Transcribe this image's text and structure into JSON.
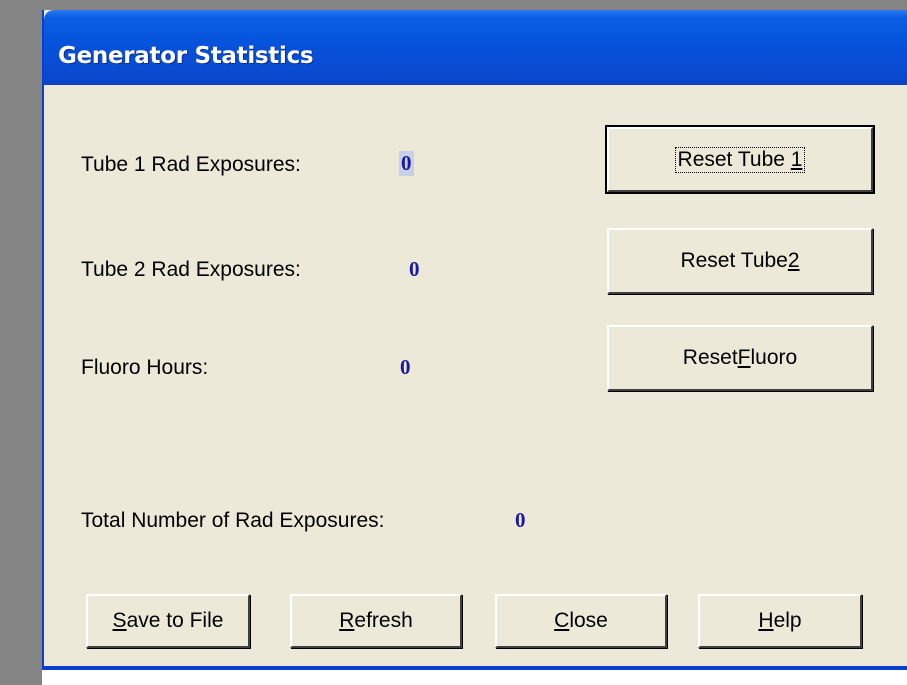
{
  "window": {
    "title": "Generator Statistics"
  },
  "stats": {
    "tube1": {
      "label": "Tube 1 Rad Exposures:",
      "value": "0"
    },
    "tube2": {
      "label": "Tube 2 Rad Exposures:",
      "value": "0"
    },
    "fluoro": {
      "label": "Fluoro Hours:",
      "value": "0"
    },
    "total": {
      "label": "Total Number of Rad Exposures:",
      "value": "0"
    }
  },
  "buttons": {
    "reset_tube1": {
      "pre": "Reset Tube ",
      "mnemonic": "1",
      "post": ""
    },
    "reset_tube2": {
      "pre": "Reset Tube ",
      "mnemonic": "2",
      "post": ""
    },
    "reset_fluoro": {
      "pre": "Reset ",
      "mnemonic": "F",
      "post": "luoro"
    },
    "save": {
      "pre": "",
      "mnemonic": "S",
      "post": "ave to File"
    },
    "refresh": {
      "pre": "",
      "mnemonic": "R",
      "post": "efresh"
    },
    "close": {
      "pre": "",
      "mnemonic": "C",
      "post": "lose"
    },
    "help": {
      "pre": "",
      "mnemonic": "H",
      "post": "elp"
    }
  },
  "colors": {
    "titlebar": "#0651d9",
    "dialog_bg": "#ece9d8",
    "value_text": "#1a1a9e"
  }
}
